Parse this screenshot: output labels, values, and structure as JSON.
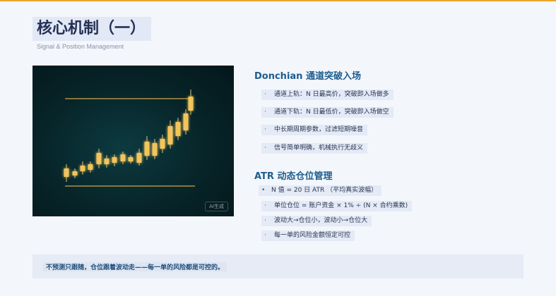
{
  "header": {
    "title": "核心机制（一）",
    "subtitle": "Signal & Position Management"
  },
  "illustration": {
    "badge": "AI生成",
    "colors": {
      "background": "#072428",
      "channel_line": "#e8b44a",
      "candle_body": "#f2c45a",
      "candle_glow": "#ffe08a"
    }
  },
  "section1": {
    "title": "Donchian 通道突破入场",
    "items": [
      "通道上轨：N 日最高价，突破即入场做多",
      "通道下轨：N 日最低价，突破即入场做空",
      "中长期周期参数，过滤短期噪音",
      "信号简单明确，机械执行无歧义"
    ]
  },
  "section2": {
    "title": "ATR 动态仓位管理",
    "items": [
      "N 值 = 20 日 ATR （平均真实波幅）",
      "单位仓位 = 账户资金 × 1% ÷ (N × 合约乘数)",
      "波动大→仓位小，波动小→仓位大",
      "每一单的风险金额恒定可控"
    ]
  },
  "footer": {
    "text": "不预测只跟随，仓位跟着波动走——每一单的风险都是可控的。"
  }
}
